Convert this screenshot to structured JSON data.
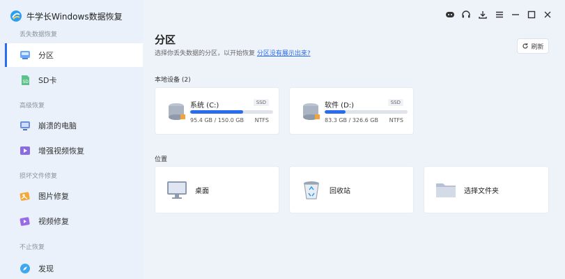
{
  "app": {
    "title": "牛学长Windows数据恢复"
  },
  "sidebar": {
    "sections": [
      {
        "label": "丢失数据恢复"
      },
      {
        "label": "高级恢复"
      },
      {
        "label": "损坏文件修复"
      },
      {
        "label": "不止恢复"
      }
    ],
    "items": [
      {
        "label": "分区",
        "icon": "partition-icon"
      },
      {
        "label": "SD卡",
        "icon": "sd-card-icon"
      },
      {
        "label": "崩溃的电脑",
        "icon": "crashed-pc-icon"
      },
      {
        "label": "增强视频恢复",
        "icon": "video-recovery-icon"
      },
      {
        "label": "图片修复",
        "icon": "photo-repair-icon"
      },
      {
        "label": "视频修复",
        "icon": "video-repair-icon"
      },
      {
        "label": "发现",
        "icon": "discover-icon"
      }
    ]
  },
  "main": {
    "title": "分区",
    "subtitle": "选择你丢失数据的分区，以开始恢复",
    "subtitle_link": "分区没有展示出来?",
    "refresh_label": "刷新",
    "local_devices_label": "本地设备 (2)",
    "drives": [
      {
        "name": "系统 (C:)",
        "badge": "SSD",
        "usage": "95.4 GB / 150.0 GB",
        "fs": "NTFS",
        "used_fraction": 0.636
      },
      {
        "name": "软件 (D:)",
        "badge": "SSD",
        "usage": "83.3 GB / 326.6 GB",
        "fs": "NTFS",
        "used_fraction": 0.255
      }
    ],
    "locations_label": "位置",
    "locations": [
      {
        "label": "桌面",
        "icon": "desktop-icon"
      },
      {
        "label": "回收站",
        "icon": "recycle-bin-icon"
      },
      {
        "label": "选择文件夹",
        "icon": "folder-icon"
      }
    ]
  },
  "colors": {
    "accent": "#2a6cf0",
    "sidebar_bg": "#eaf1fb",
    "main_bg": "#eef3fa"
  }
}
